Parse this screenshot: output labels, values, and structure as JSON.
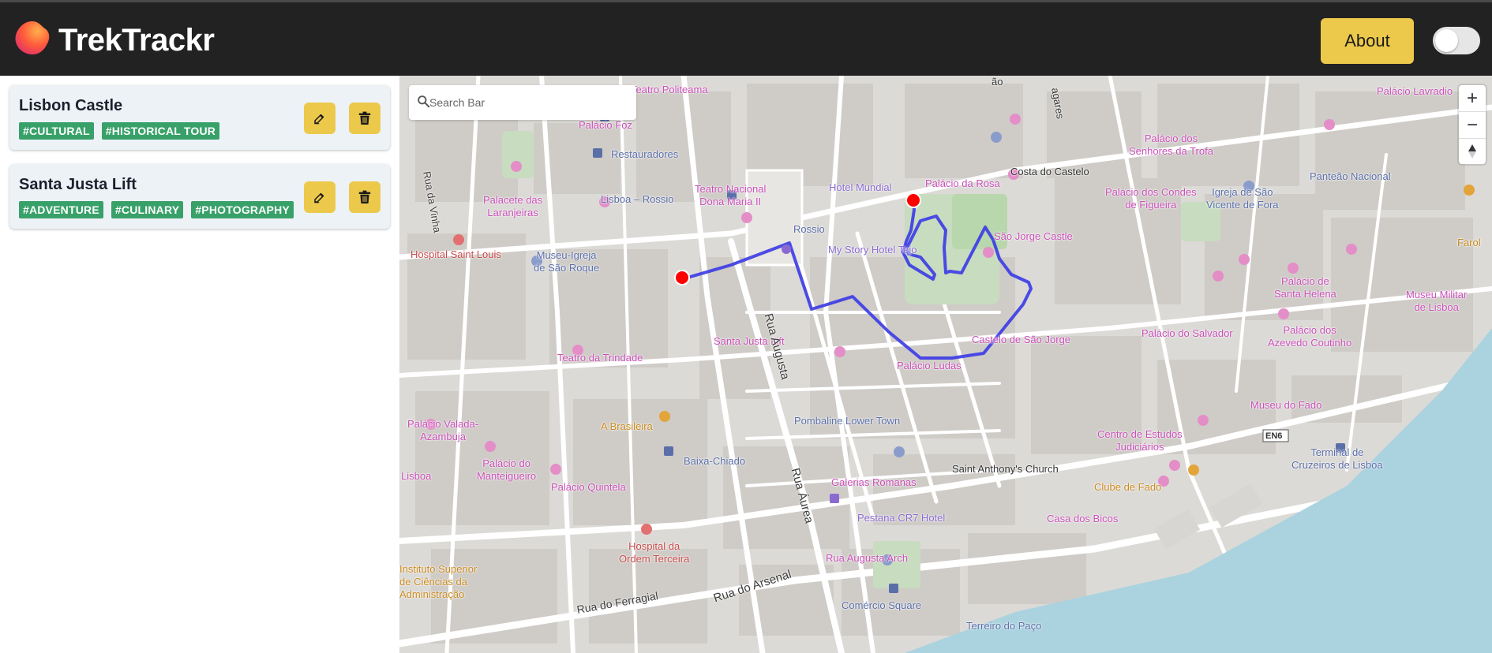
{
  "app": {
    "name": "TrekTrackr",
    "about_label": "About",
    "theme_toggle_on": false
  },
  "trips": [
    {
      "title": "Lisbon Castle",
      "tags": [
        "#CULTURAL",
        "#HISTORICAL TOUR"
      ]
    },
    {
      "title": "Santa Justa Lift",
      "tags": [
        "#ADVENTURE",
        "#CULINARY",
        "#PHOTOGRAPHY"
      ]
    }
  ],
  "map": {
    "search": {
      "placeholder": "Search Bar"
    },
    "controls": {
      "zoom_in": "+",
      "zoom_out": "−"
    },
    "route": {
      "color": "#3a3ae6",
      "start": "Santa Justa Lift",
      "end": "São Jorge Castle"
    },
    "labels": {
      "teatro_politeama": "Teatro Politeama",
      "palacio_foz": "Palácio Foz",
      "restauradores": "Restauradores",
      "lisboa_rossio": "Lisboa – Rossio",
      "teatro_nacional": "Teatro Nacional\nDona Maria II",
      "hotel_mundial": "Hotel Mundial",
      "rossio": "Rossio",
      "my_story_hotel": "My Story Hotel Tejo",
      "palacio_rosa": "Palácio da Rosa",
      "costa_castelo": "Costa do Castelo",
      "sao_jorge_castle": "São Jorge Castle",
      "palacio_senhores_trofa": "Palácio dos\nSenhores da Trofa",
      "palacio_condes_figueira": "Palácio dos Condes\nde Figueira",
      "igreja_sao_vicente": "Igreja de São\nVicente de Fora",
      "panteao": "Panteão Nacional",
      "palacio_lavradio": "Palácio Lavradio",
      "farol": "Farol",
      "palacio_santa_helena": "Palácio de\nSanta Helena",
      "museu_militar": "Museu Militar\nde Lisboa",
      "palacio_azevedo": "Palácio dos\nAzevedo Coutinho",
      "palacio_salvador": "Palácio do Salvador",
      "castelo_sao_jorge": "Castelo de São Jorge",
      "palacio_ludas": "Palácio Ludas",
      "santa_justa": "Santa Justa Lift",
      "rua_augusta": "Rua Augusta",
      "rua_vinha": "Rua da Vinha",
      "palacete_laranjeiras": "Palacete das\nLaranjeiras",
      "hospital_saint_louis": "Hospital Saint Louis",
      "museu_igreja": "Museu-Igreja\nde São Roque",
      "teatro_trindade": "Teatro da Trindade",
      "palacio_valada": "Palácio Valada-\nAzambuja",
      "palacio_manteigueiro": "Palácio do\nManteigueiro",
      "lisboa_frag": "Lisboa",
      "a_brasileira": "A Brasileira",
      "baixa_chiado": "Baixa-Chiado",
      "palacio_quintela": "Palácio Quintela",
      "pombaline": "Pombaline Lower Town",
      "saint_anthony": "Saint Anthony's Church",
      "centro_estudos": "Centro de Estudos\nJudiciários",
      "museu_fado": "Museu do Fado",
      "clube_fado": "Clube de Fado",
      "casa_bicos": "Casa dos Bicos",
      "galerias_romanas": "Galerias Romanas",
      "rua_aurea": "Rua Áurea",
      "pestana_hotel": "Pestana CR7 Hotel",
      "hospital_ordem": "Hospital da\nOrdem Terceira",
      "instituto": "Instituto Superior\nde Ciências da\nAdministração",
      "rua_ferragial": "Rua do Ferragial",
      "rua_arsenal": "Rua do Arsenal",
      "rua_augusta_arch": "Rua Augusta Arch",
      "comercio_square": "Comércio Square",
      "terreiro_paco": "Terreiro do Paço",
      "terminal_cruzeiros": "Terminal de\nCruzeiros de Lisboa",
      "en6": "EN6",
      "fragment_top": "ão",
      "fragment_lagares": "agares"
    }
  }
}
